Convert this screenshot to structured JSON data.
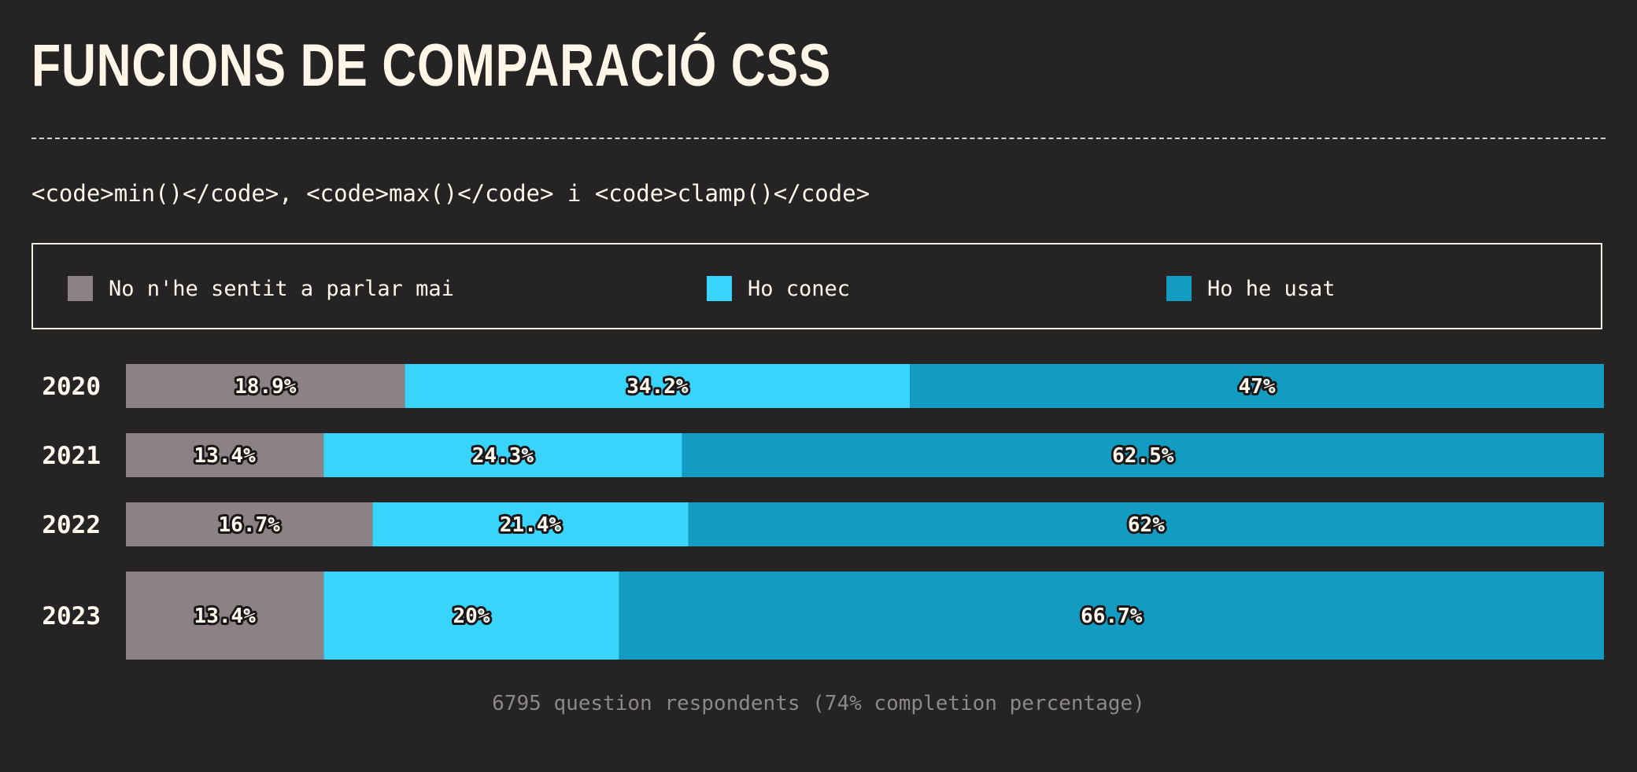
{
  "title": "FUNCIONS DE COMPARACIÓ CSS",
  "subtitle": "<code>min()</code>, <code>max()</code> i <code>clamp()</code>",
  "legend": [
    {
      "label": "No n'he sentit a parlar mai",
      "color": "#8c8286"
    },
    {
      "label": "Ho conec",
      "color": "#38d4fc"
    },
    {
      "label": "Ho he usat",
      "color": "#139cc2"
    }
  ],
  "footnote": "6795 question respondents (74% completion percentage)",
  "chart_data": {
    "type": "bar",
    "orientation": "horizontal",
    "stacked": true,
    "normalized": true,
    "categories": [
      "2020",
      "2021",
      "2022",
      "2023"
    ],
    "series": [
      {
        "name": "No n'he sentit a parlar mai",
        "values": [
          18.9,
          13.4,
          16.7,
          13.4
        ],
        "labels": [
          "18.9%",
          "13.4%",
          "16.7%",
          "13.4%"
        ],
        "color": "#8c8286"
      },
      {
        "name": "Ho conec",
        "values": [
          34.2,
          24.3,
          21.4,
          20
        ],
        "labels": [
          "34.2%",
          "24.3%",
          "21.4%",
          "20%"
        ],
        "color": "#38d4fc"
      },
      {
        "name": "Ho he usat",
        "values": [
          47,
          62.5,
          62,
          66.7
        ],
        "labels": [
          "47%",
          "62.5%",
          "62%",
          "66.7%"
        ],
        "color": "#139cc2"
      }
    ],
    "xlim": [
      0,
      100
    ],
    "grid": false,
    "legend": "top"
  }
}
